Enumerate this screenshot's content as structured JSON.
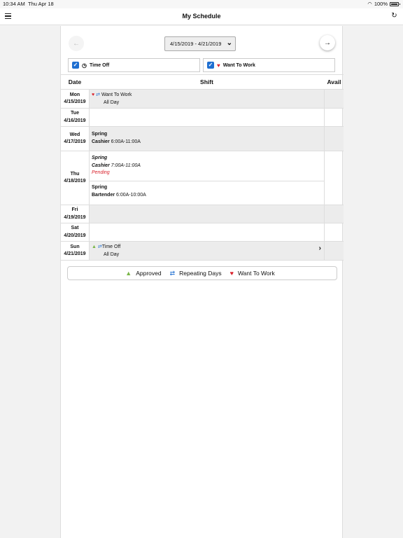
{
  "status_bar": {
    "time": "10:34 AM",
    "date": "Thu Apr 18",
    "battery": "100%"
  },
  "nav": {
    "title": "My Schedule",
    "menu_icon": "hamburger-icon",
    "refresh_icon": "refresh-icon"
  },
  "toolbar": {
    "date_range": "4/15/2019 - 4/21/2019"
  },
  "filters": [
    {
      "label": "Time Off",
      "checked": true,
      "icon": "clock-icon"
    },
    {
      "label": "Want To Work",
      "checked": true,
      "icon": "heart-icon"
    }
  ],
  "table": {
    "headers": {
      "date": "Date",
      "shift": "Shift",
      "avail": "Avail"
    },
    "rows": [
      {
        "day": "Mon",
        "date": "4/15/2019",
        "entries": [
          {
            "type": "Want To Work",
            "detail": "All Day"
          }
        ]
      },
      {
        "day": "Tue",
        "date": "4/16/2019",
        "entries": []
      },
      {
        "day": "Wed",
        "date": "4/17/2019",
        "entries": [
          {
            "location": "Spring",
            "role": "Cashier",
            "time": "6:00A-11:00A"
          }
        ]
      },
      {
        "day": "Thu",
        "date": "4/18/2019",
        "entries": [
          {
            "location": "Spring",
            "role": "Cashier",
            "time": "7:00A-11:00A",
            "status": "Pending"
          },
          {
            "location": "Spring",
            "role": "Bartender",
            "time": "6:00A-10:00A"
          }
        ]
      },
      {
        "day": "Fri",
        "date": "4/19/2019",
        "entries": []
      },
      {
        "day": "Sat",
        "date": "4/20/2019",
        "entries": []
      },
      {
        "day": "Sun",
        "date": "4/21/2019",
        "entries": [
          {
            "type": "Time Off",
            "detail": "All Day"
          }
        ]
      }
    ]
  },
  "legend": {
    "approved": "Approved",
    "repeating": "Repeating Days",
    "want_to_work": "Want To Work"
  },
  "colors": {
    "heart": "#d9232d",
    "repeat": "#1f6fd1",
    "approved": "#7ab648",
    "pending": "#d9232d",
    "checkbox": "#1f6fd1"
  }
}
